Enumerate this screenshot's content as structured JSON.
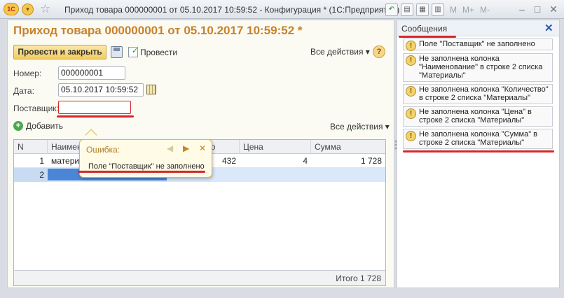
{
  "window": {
    "app_logo": "1С",
    "title": "Приход товара 000000001 от 05.10.2017 10:59:52 - Конфигурация * (1С:Предприятие)",
    "toolbar_m": "M",
    "toolbar_m_plus": "M+",
    "toolbar_m_minus": "M-",
    "icons": [
      "back-arrow-icon",
      "document-icon",
      "calendar-icon",
      "calculator-icon"
    ]
  },
  "form": {
    "title": "Приход товара 000000001 от 05.10.2017 10:59:52 *",
    "buttons": {
      "post_and_close": "Провести и закрыть",
      "post": "Провести",
      "all_actions": "Все действия ▾",
      "help": "?"
    },
    "fields": {
      "number_label": "Номер:",
      "number_value": "000000001",
      "date_label": "Дата:",
      "date_value": "05.10.2017 10:59:52",
      "supplier_label": "Поставщик:",
      "supplier_value": ""
    },
    "table": {
      "add_label": "Добавить",
      "all_actions": "Все действия ▾",
      "columns": [
        "N",
        "Наименование",
        "Количество",
        "Цена",
        "Сумма"
      ],
      "rows": [
        {
          "n": "1",
          "name": "материнская плата",
          "qty": "432",
          "price": "4",
          "sum": "1 728"
        },
        {
          "n": "2",
          "name": "",
          "qty": "",
          "price": "",
          "sum": ""
        }
      ],
      "total": "Итого 1 728"
    },
    "error_popup": {
      "header": "Ошибка:",
      "message": "Поле \"Поставщик\" не заполнено",
      "prev": "◀",
      "next": "▶",
      "close": "✕"
    }
  },
  "messages": {
    "title": "Сообщения",
    "close": "✕",
    "items": [
      "Поле \"Поставщик\" не заполнено",
      "Не заполнена колонка \"Наименование\" в строке 2 списка \"Материалы\"",
      "Не заполнена колонка \"Количество\" в строке 2 списка \"Материалы\"",
      "Не заполнена колонка \"Цена\" в строке 2 списка \"Материалы\"",
      "Не заполнена колонка \"Сумма\" в строке 2 списка \"Материалы\""
    ]
  },
  "colors": {
    "title_orange": "#c8822a",
    "highlight_red": "#d6262a",
    "selection_blue": "#4b86d6"
  }
}
